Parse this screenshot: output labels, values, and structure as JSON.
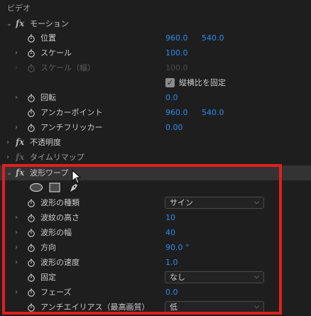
{
  "header": {
    "title": "ビデオ"
  },
  "motion": {
    "name": "モーション",
    "props": {
      "position": {
        "label": "位置",
        "x": "960.0",
        "y": "540.0"
      },
      "scale": {
        "label": "スケール",
        "value": "100.0"
      },
      "scale_width": {
        "label": "スケール（幅）",
        "value": "100.0"
      },
      "uniform": {
        "label": "縦横比を固定",
        "checked": true
      },
      "rotation": {
        "label": "回転",
        "value": "0.0"
      },
      "anchor": {
        "label": "アンカーポイント",
        "x": "960.0",
        "y": "540.0"
      },
      "antiflicker": {
        "label": "アンチフリッカー",
        "value": "0.00"
      }
    }
  },
  "opacity": {
    "name": "不透明度"
  },
  "timeremap": {
    "name": "タイムリマップ"
  },
  "wave": {
    "name": "波形ワープ",
    "props": {
      "wave_type": {
        "label": "波形の種類",
        "value": "サイン"
      },
      "wave_height": {
        "label": "波紋の高さ",
        "value": "10"
      },
      "wave_width": {
        "label": "波形の幅",
        "value": "40"
      },
      "direction": {
        "label": "方向",
        "value": "90.0 °"
      },
      "wave_speed": {
        "label": "波形の速度",
        "value": "1.0"
      },
      "pinning": {
        "label": "固定",
        "value": "なし"
      },
      "phase": {
        "label": "フェーズ",
        "value": "0.0"
      },
      "antialias": {
        "label": "アンチエイリアス（最高画質）",
        "value": "低"
      }
    }
  },
  "colors": {
    "accent": "#2d8ceb",
    "highlight": "#e0201f"
  }
}
